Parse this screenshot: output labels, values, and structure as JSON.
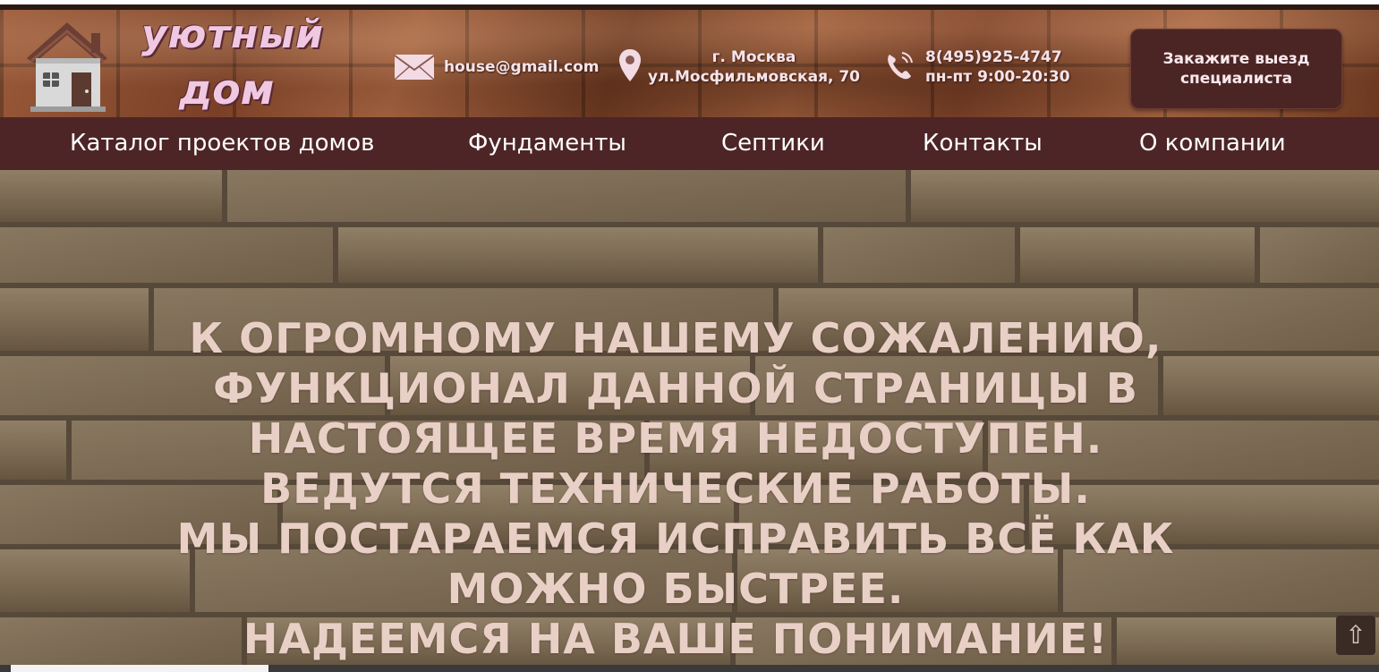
{
  "brand": {
    "line1": "уютный",
    "line2": "дом"
  },
  "contacts": {
    "email": "house@gmail.com",
    "city": "г. Москва",
    "street": "ул.Мосфильмовская, 70",
    "phone": "8(495)925-4747",
    "hours": "пн-пт 9:00-20:30"
  },
  "order_button": {
    "line1": "Закажите выезд",
    "line2": "специалиста"
  },
  "nav": {
    "items": [
      {
        "label": "Каталог проектов домов"
      },
      {
        "label": "Фундаменты"
      },
      {
        "label": "Септики"
      },
      {
        "label": "Контакты"
      },
      {
        "label": "О компании"
      }
    ]
  },
  "message": {
    "lines": [
      "К ОГРОМНОМУ НАШЕМУ СОЖАЛЕНИЮ,",
      "ФУНКЦИОНАЛ ДАННОЙ СТРАНИЦЫ В",
      "НАСТОЯЩЕЕ ВРЕМЯ НЕДОСТУПЕН.",
      "ВЕДУТСЯ ТЕХНИЧЕСКИЕ РАБОТЫ.",
      "МЫ ПОСТАРАЕМСЯ ИСПРАВИТЬ ВСЁ КАК",
      "МОЖНО БЫСТРЕЕ.",
      "НАДЕЕМСЯ НА ВАШЕ ПОНИМАНИЕ!"
    ]
  },
  "scroll_top": {
    "glyph": "⇧",
    "icon": "arrow-up-icon"
  },
  "colors": {
    "nav_bg": "#4d2526",
    "button_bg": "#4b2524",
    "logo_text": "#f0c8e2",
    "message_text": "#e9d0c6"
  }
}
